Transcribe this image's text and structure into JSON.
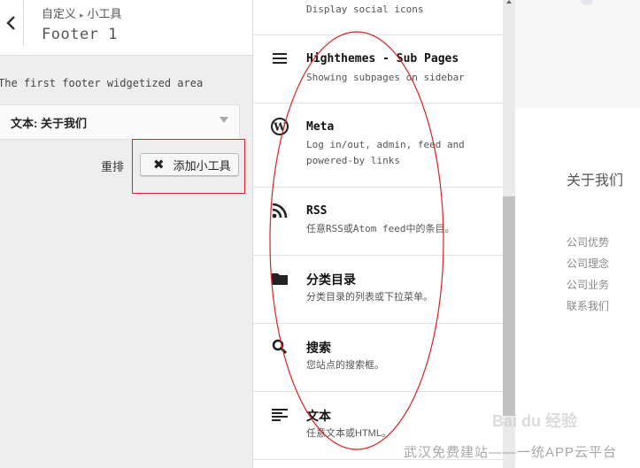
{
  "panel": {
    "breadcrumb_parent": "自定义",
    "breadcrumb_child": "小工具",
    "title": "Footer 1",
    "area_description": "The first footer widgetized area",
    "widget_title": "文本: 关于我们",
    "reorder_label": "重排",
    "add_widget_label": "添加小工具"
  },
  "widget_list": [
    {
      "icon": "",
      "name": "",
      "desc": "Display social icons"
    },
    {
      "icon": "list-icon",
      "name": "Highthemes - Sub Pages",
      "desc": "Showing subpages on sidebar"
    },
    {
      "icon": "wordpress-icon",
      "name": "Meta",
      "desc": "Log in/out, admin, feed and powered-by links"
    },
    {
      "icon": "rss-icon",
      "name": "RSS",
      "desc": "任意RSS或Atom feed中的条目。"
    },
    {
      "icon": "folder-icon",
      "name": "分类目录",
      "desc": "分类目录的列表或下拉菜单。"
    },
    {
      "icon": "search-icon",
      "name": "搜索",
      "desc": "您站点的搜索框。"
    },
    {
      "icon": "text-icon",
      "name": "文本",
      "desc": "任意文本或HTML。"
    }
  ],
  "preview": {
    "heading": "关于我们",
    "links": [
      "公司优势",
      "公司理念",
      "公司业务",
      "联系我们"
    ]
  },
  "watermark": "武汉免费建站——一统APP云平台",
  "baidu_logo": "Bai du 经验",
  "colors": {
    "annotation_red": "#dd2222"
  }
}
